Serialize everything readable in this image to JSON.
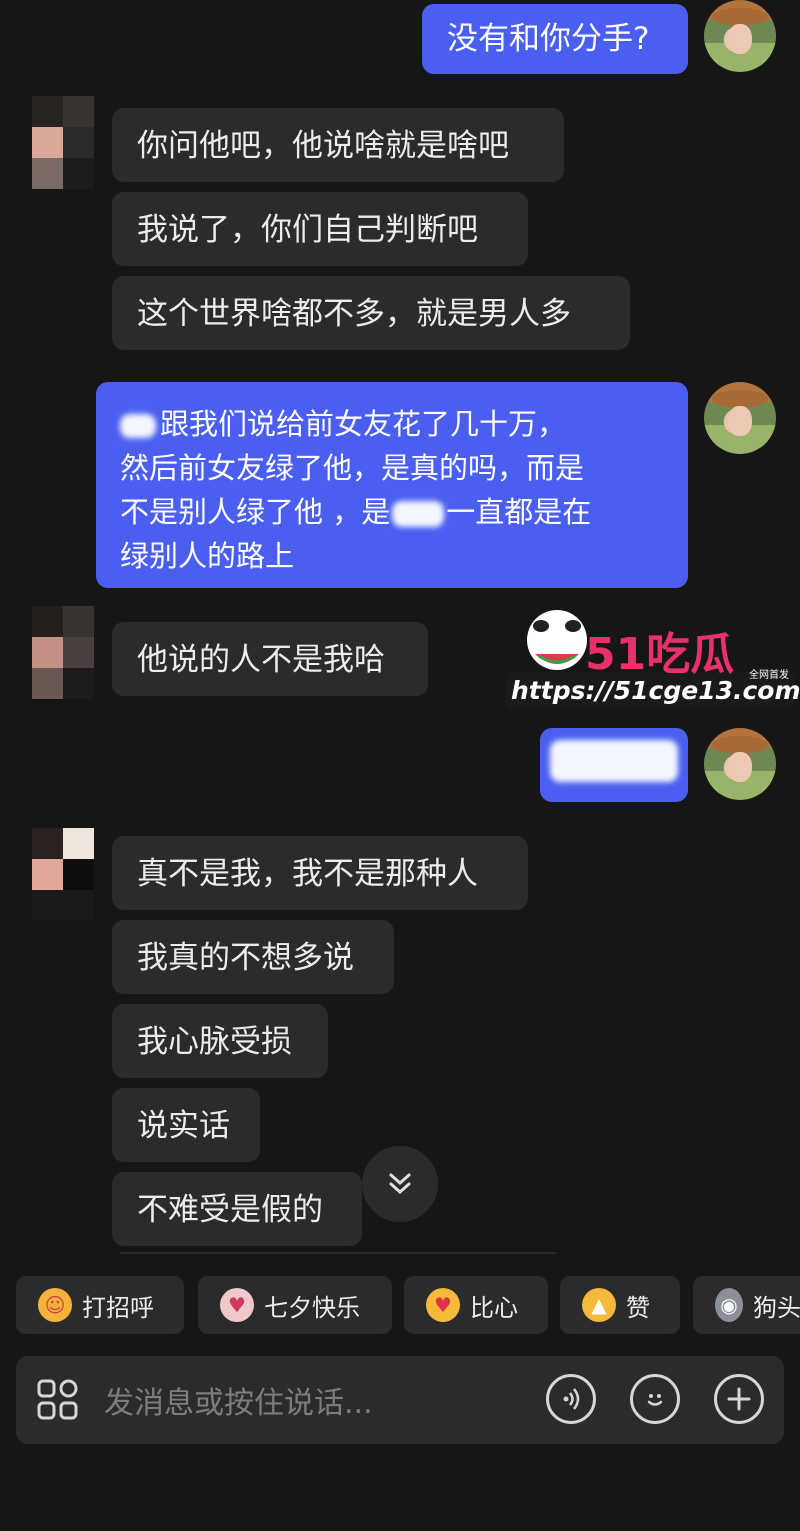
{
  "messages": [
    {
      "id": "m1",
      "side": "out",
      "text": "没有和你分手?"
    },
    {
      "id": "m2",
      "side": "in",
      "text": "你问他吧，他说啥就是啥吧"
    },
    {
      "id": "m3",
      "side": "in",
      "text": "我说了，你们自己判断吧"
    },
    {
      "id": "m4",
      "side": "in",
      "text": "这个世界啥都不多，就是男人多"
    },
    {
      "id": "m5",
      "side": "out",
      "lines": [
        "跟我们说给前女友花了几十万，",
        "然后前女友绿了他，是真的吗，而是",
        "不是别人绿了他 ，是",
        "一直都是在",
        "绿别人的路上"
      ]
    },
    {
      "id": "m6",
      "side": "in",
      "text": "他说的人不是我哈"
    },
    {
      "id": "m7",
      "side": "out",
      "text": ""
    },
    {
      "id": "m8",
      "side": "in",
      "text": "真不是我，我不是那种人"
    },
    {
      "id": "m9",
      "side": "in",
      "text": "我真的不想多说"
    },
    {
      "id": "m10",
      "side": "in",
      "text": "我心脉受损"
    },
    {
      "id": "m11",
      "side": "in",
      "text": "说实话"
    },
    {
      "id": "m12",
      "side": "in",
      "text": "不难受是假的"
    }
  ],
  "quick_replies": [
    {
      "label": "打招呼",
      "icon": "smile-face-emoji"
    },
    {
      "label": "七夕快乐",
      "icon": "cupid-emoji"
    },
    {
      "label": "比心",
      "icon": "heart-hand-emoji"
    },
    {
      "label": "赞",
      "icon": "thumbs-up-emoji"
    },
    {
      "label": "狗头",
      "icon": "dog-head-emoji"
    }
  ],
  "input": {
    "placeholder": "发消息或按住说话..."
  },
  "watermark": {
    "brand": "51吃瓜",
    "tag": "全网首发",
    "url": "https://51cge13.com"
  },
  "colors": {
    "background": "#161616",
    "incoming": "#2b2b2d",
    "outgoing": "#4a5ff0"
  }
}
